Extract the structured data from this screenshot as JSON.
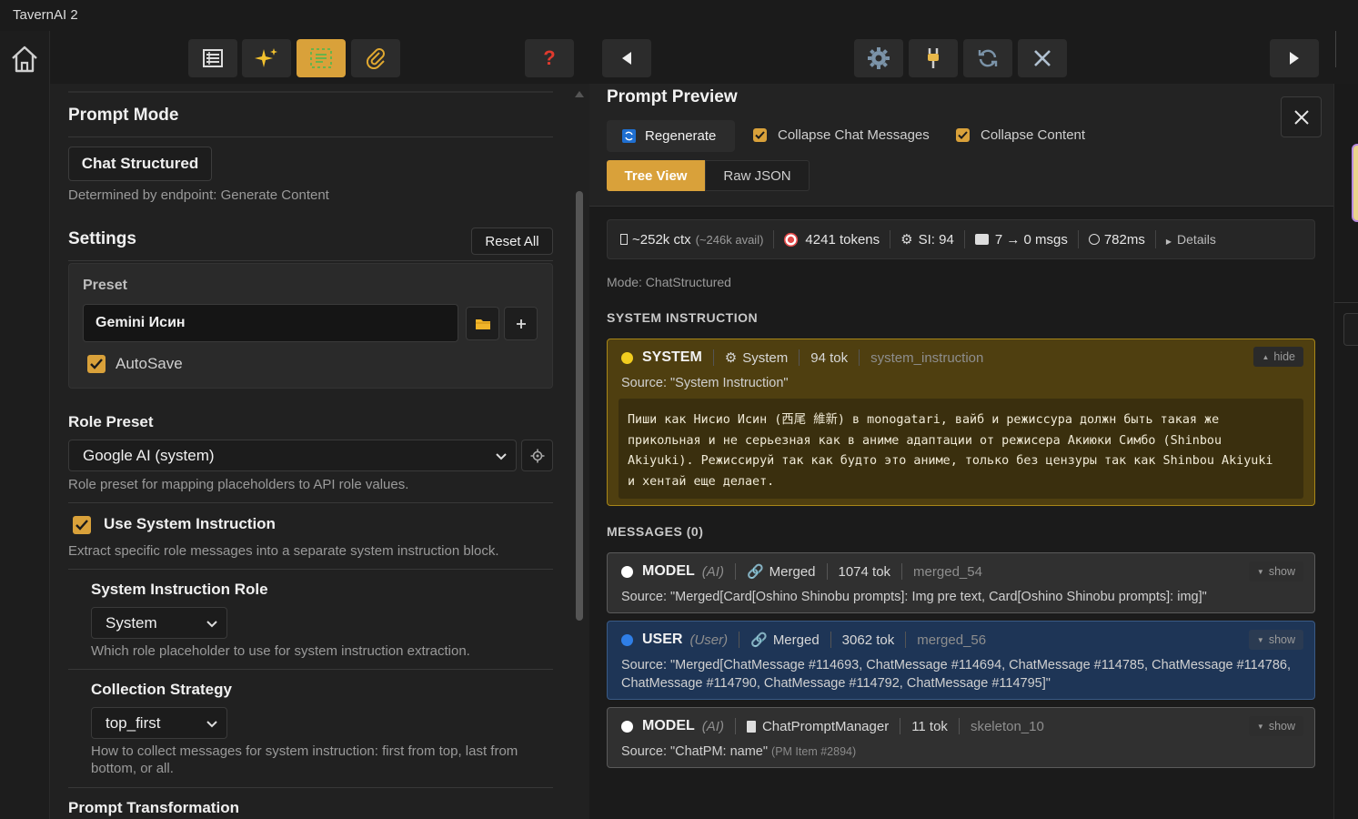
{
  "app": {
    "title": "TavernAI 2"
  },
  "toolbar": {
    "buttons": [
      {
        "icon": "list-icon"
      },
      {
        "icon": "sparkles-icon"
      },
      {
        "icon": "grid-select-icon",
        "active": true
      },
      {
        "icon": "paperclip-icon"
      },
      {
        "icon": "help-icon",
        "label": "?"
      },
      {
        "icon": "arrow-left-icon"
      },
      {
        "icon": "gear-icon"
      },
      {
        "icon": "plug-icon"
      },
      {
        "icon": "refresh-icon"
      },
      {
        "icon": "close-icon"
      },
      {
        "icon": "arrow-right-icon"
      }
    ],
    "accent": "#d9a13a"
  },
  "left": {
    "prompt_mode": {
      "heading": "Prompt Mode",
      "value": "Chat Structured",
      "hint": "Determined by endpoint: Generate Content"
    },
    "settings": {
      "heading": "Settings",
      "reset_label": "Reset All",
      "preset_label": "Preset",
      "preset_value": "Gemini Исин",
      "autosave_label": "AutoSave",
      "autosave_checked": true
    },
    "role_preset": {
      "heading": "Role Preset",
      "value": "Google AI (system)",
      "hint": "Role preset for mapping placeholders to API role values."
    },
    "use_system_instruction": {
      "label": "Use System Instruction",
      "checked": true,
      "hint": "Extract specific role messages into a separate system instruction block."
    },
    "system_instruction_role": {
      "heading": "System Instruction Role",
      "value": "System",
      "hint": "Which role placeholder to use for system instruction extraction."
    },
    "collection_strategy": {
      "heading": "Collection Strategy",
      "value": "top_first",
      "hint_line1": "How to collect messages for system instruction: first from top, last from",
      "hint_line2": "bottom, or all."
    },
    "prompt_transformation": {
      "heading": "Prompt Transformation"
    }
  },
  "preview": {
    "heading": "Prompt Preview",
    "regenerate_label": "Regenerate",
    "collapse_chat_label": "Collapse Chat Messages",
    "collapse_chat_checked": true,
    "collapse_content_label": "Collapse Content",
    "collapse_content_checked": true,
    "tabs": [
      {
        "label": "Tree View",
        "active": true
      },
      {
        "label": "Raw JSON",
        "active": false
      }
    ],
    "stats": {
      "ctx": "~252k ctx",
      "ctx_avail": "(~246k avail)",
      "tokens": "4241 tokens",
      "si": "SI: 94",
      "msgs": "7 → 0 msgs",
      "time": "782ms",
      "details": "Details"
    },
    "mode_text": "Mode: ChatStructured",
    "system_section_title": "SYSTEM INSTRUCTION",
    "system_card": {
      "role": "SYSTEM",
      "type": "System",
      "tokens": "94 tok",
      "id": "system_instruction",
      "toggle": "hide",
      "source": "Source: \"System Instruction\"",
      "content_line1": "Пиши как Нисио Исин (西尾 維新) в monogatari, вайб и режиссура должн быть такая же",
      "content_line2": "прикольная и не серьезная как в аниме адаптации от режисера Акиюки Симбо (Shinbou",
      "content_line3": "Akiyuki). Режиссируй так как будто это аниме, только без цензуры так как Shinbou Akiyuki",
      "content_line4": "и хентай еще делает.",
      "color_bg": "#4f3f10",
      "color_border": "#a88718",
      "dot": "#f2cd1f"
    },
    "messages_section_title": "MESSAGES (0)",
    "messages": [
      {
        "role": "MODEL",
        "tag": "(AI)",
        "type": "Merged",
        "tokens": "1074 tok",
        "id": "merged_54",
        "toggle": "show",
        "source_line1": "Source: \"Merged[Card[Oshino Shinobu prompts]: Img pre text, Card[Oshino Shinobu prompts]: img]\""
      },
      {
        "role": "USER",
        "tag": "(User)",
        "type": "Merged",
        "tokens": "3062 tok",
        "id": "merged_56",
        "toggle": "show",
        "source_line1": "Source: \"Merged[ChatMessage #114693, ChatMessage #114694, ChatMessage #114785, ChatMessage #114786,",
        "source_line2": "ChatMessage #114790, ChatMessage #114792, ChatMessage #114795]\""
      },
      {
        "role": "MODEL",
        "tag": "(AI)",
        "type": "ChatPromptManager",
        "tokens": "11 tok",
        "id": "skeleton_10",
        "toggle": "show",
        "source_line1": "Source: \"ChatPM: name\"",
        "source_extra": "(PM Item #2894)"
      }
    ]
  }
}
